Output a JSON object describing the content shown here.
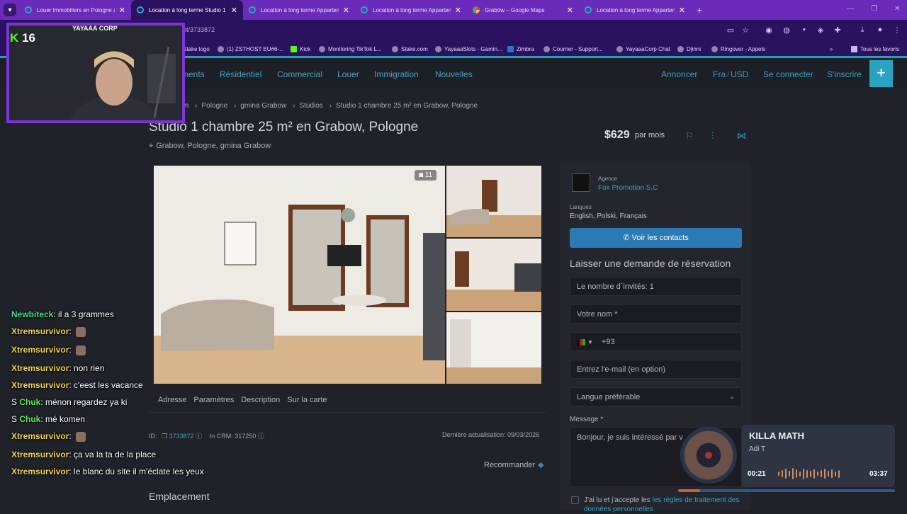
{
  "browser": {
    "tabs": [
      {
        "title": "Louer immobiliers en Pologne à",
        "favicon": "site-icon",
        "active": false
      },
      {
        "title": "Location à long terme Studio 1",
        "favicon": "site-icon",
        "active": true
      },
      {
        "title": "Location à long terme Appartem",
        "favicon": "site-icon",
        "active": false
      },
      {
        "title": "Location à long terme Appartem",
        "favicon": "site-icon",
        "active": false
      },
      {
        "title": "Grabów – Google Maps",
        "favicon": "maps-icon",
        "active": false
      },
      {
        "title": "Location à long terme Appartem",
        "favicon": "site-icon",
        "active": false
      }
    ],
    "url": "nt/3733872",
    "bookmarks": [
      "Stake logo",
      "(1) ZSTHOST EU#6-...",
      "Kick",
      "Monitoring TikTok L...",
      "Stake.com",
      "YayaaaSlots - Gamin...",
      "Zimbra",
      "Courrier - Support...",
      "YayaaaCorp Chat",
      "Djinni",
      "Ringover - Appels"
    ],
    "bookmarks_more": "»",
    "all_bookmarks": "Tous les favoris"
  },
  "site": {
    "nav_left": [
      "ments",
      "Résidentiel",
      "Commercial",
      "Louer",
      "Immigration",
      "Nouvelles"
    ],
    "nav_right": [
      "Annoncer",
      "Fra",
      "USD",
      "Se connecter",
      "S'inscrire"
    ],
    "breadcrumb": [
      "m",
      "Pologne",
      "gmina Grabow",
      "Studios",
      "Studio 1 chambre 25 m² en Grabow, Pologne"
    ],
    "title": "Studio 1 chambre 25 m² en Grabow, Pologne",
    "location": "Grabow, Pologne, gmina Grabow",
    "price": "$629",
    "price_unit": "par mois",
    "photo_count": "11",
    "section_tabs": [
      "Adresse",
      "Paramètres",
      "Description",
      "Sur la carte"
    ],
    "id_label": "ID:",
    "id_value": "3733872",
    "crm": "In CRM: 317250",
    "updated": "Dernière actualisation: 09/03/2026",
    "recommend": "Recommander",
    "emplacement": "Emplacement"
  },
  "sidebar": {
    "agency_label": "Agence",
    "agency_name": "Fox Promotion S.C",
    "languages_label": "Langues",
    "languages": "English, Polski, Français",
    "contact_btn": "Voir les contacts",
    "reservation_title": "Laisser une demande de réservation",
    "guests": "Le nombre d`invités: 1",
    "name_placeholder": "Votre nom *",
    "phone_code": "+93",
    "email_placeholder": "Entrez l'e-mail (en option)",
    "language_select": "Langue préférable",
    "message_label": "Message *",
    "message_value": "Bonjour, je suis intéressé par v",
    "consent_text": "J'ai lu et j'accepte les",
    "consent_link": "les règles de traitement des données personnelles"
  },
  "overlay": {
    "kick_count": "16",
    "kick_letter": "K",
    "corp_name": "YAYAAA CORP",
    "chat": [
      {
        "user": "Newbiteck",
        "color": "#3fe08a",
        "text": "il a 3 grammes",
        "badge": "",
        "emote": false
      },
      {
        "user": "Xtremsurvivor",
        "color": "#f2d64a",
        "text": "",
        "badge": "",
        "emote": true
      },
      {
        "user": "Xtremsurvivor",
        "color": "#f2d64a",
        "text": "",
        "badge": "",
        "emote": true
      },
      {
        "user": "Xtremsurvivor",
        "color": "#f2d64a",
        "text": "non rien",
        "badge": "",
        "emote": false
      },
      {
        "user": "Xtremsurvivor",
        "color": "#f2d64a",
        "text": "c'eest les vacance",
        "badge": "",
        "emote": false
      },
      {
        "user": "Chuk",
        "color": "#5df05d",
        "text": "ménon regardez ya ki",
        "badge": "S",
        "emote": false
      },
      {
        "user": "Chuk",
        "color": "#5df05d",
        "text": "mé komen",
        "badge": "S",
        "emote": false
      },
      {
        "user": "Xtremsurvivor",
        "color": "#f2d64a",
        "text": "",
        "badge": "",
        "emote": true
      },
      {
        "user": "Xtremsurvivor",
        "color": "#f2d64a",
        "text": "ça va la ta de la place",
        "badge": "",
        "emote": false
      },
      {
        "user": "Xtremsurvivor",
        "color": "#f2d64a",
        "text": "le blanc du site il m'éclate les yeux",
        "badge": "",
        "emote": false
      }
    ],
    "music": {
      "song": "KILLA MATH",
      "artist": "Adi T",
      "time_current": "00:21",
      "time_total": "03:37",
      "progress": 0.1
    }
  },
  "colors": {
    "accent": "#2aa3c3",
    "browser_purple": "#6a2bb8",
    "webcam_border": "#7d33d6"
  }
}
